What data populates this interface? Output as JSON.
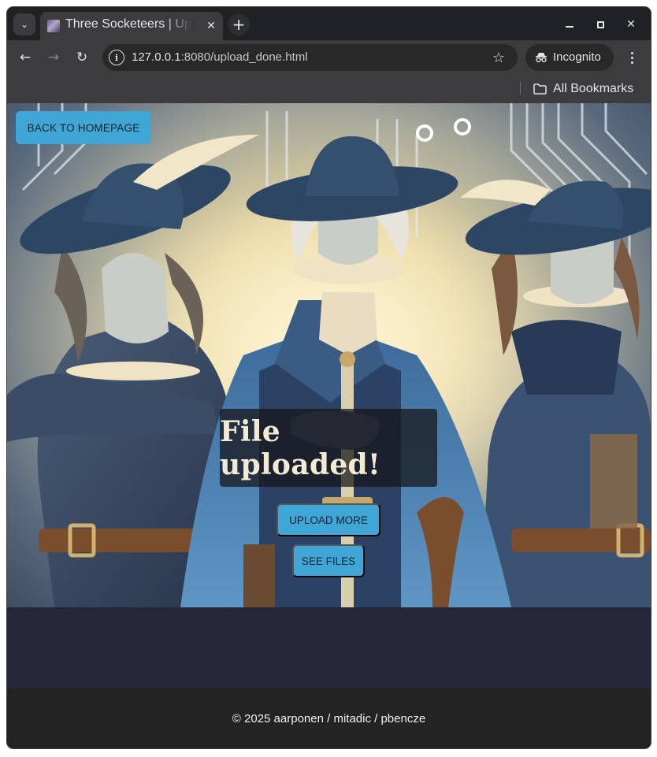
{
  "browser": {
    "tab_title": "Three Socketeers | Upload",
    "url_host": "127.0.0.1",
    "url_rest": ":8080/upload_done.html",
    "incognito_label": "Incognito",
    "bookmarks_label": "All Bookmarks",
    "new_tab_glyph": "+",
    "tab_close_glyph": "✕",
    "close_window_glyph": "✕",
    "back_glyph": "←",
    "forward_glyph": "→",
    "reload_glyph": "↻",
    "star_glyph": "☆",
    "tab_search_glyph": "⌄"
  },
  "page": {
    "back_button_label": "BACK TO HOMEPAGE",
    "status_message": "File uploaded!",
    "upload_more_label": "UPLOAD MORE",
    "see_files_label": "SEE FILES",
    "footer_text": "© 2025 aarponen / mitadic / pbencze"
  },
  "colors": {
    "button_bg": "#3fa6d5",
    "page_bg": "#242738",
    "footer_bg": "#232323",
    "browser_chrome": "#3c3c3f"
  }
}
